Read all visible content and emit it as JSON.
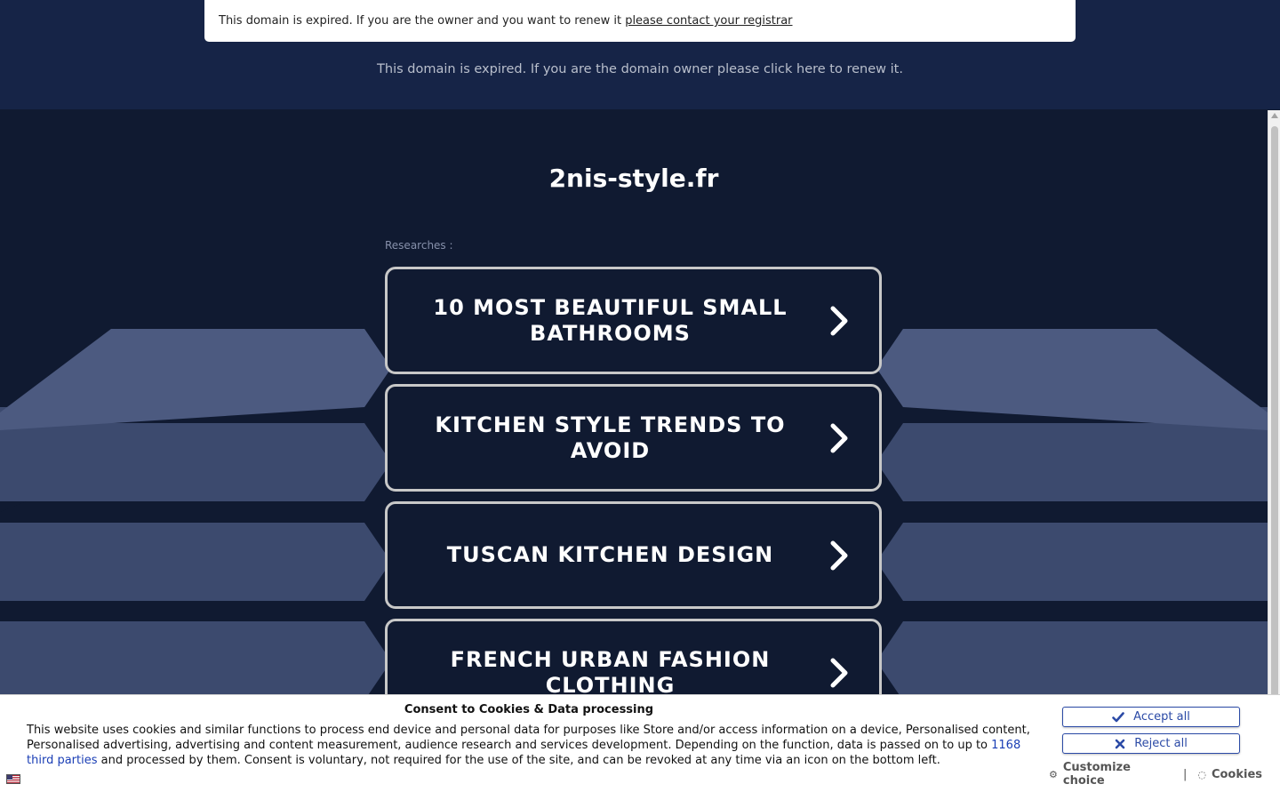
{
  "banner": {
    "notice_text": "This domain is expired. If you are the owner and you want to renew it ",
    "notice_link": "please contact your registrar",
    "renew_text": "This domain is expired. If you are the domain owner please click here to renew it."
  },
  "main": {
    "site_title": "2nis-style.fr",
    "researches_label": "Researches :",
    "links": [
      {
        "label": "10 MOST BEAUTIFUL SMALL BATHROOMS"
      },
      {
        "label": "KITCHEN STYLE TRENDS TO AVOID"
      },
      {
        "label": "TUSCAN KITCHEN DESIGN"
      },
      {
        "label": "FRENCH URBAN FASHION CLOTHING"
      }
    ]
  },
  "consent": {
    "title": "Consent to Cookies & Data processing",
    "text_before": "This website uses cookies and similar functions to process end device and personal data for purposes like Store and/or access information on a device, Personalised content, Personalised advertising, advertising and content measurement, audience research and services development. Depending on the function, data is passed on to up to ",
    "third_parties_link": "1168 third parties",
    "text_after": " and processed by them. Consent is voluntary, not required for the use of the site, and can be revoked at any time via an icon on the bottom left.",
    "accept_label": "Accept all",
    "reject_label": "Reject all",
    "customize_label": "Customize choice",
    "separator": "|",
    "cookies_label": "Cookies"
  },
  "colors": {
    "page_bg": "#101a31",
    "band_bg": "#162447",
    "accent_blue": "#2b4aa6",
    "card_border": "#c8c8c8"
  },
  "icons": {
    "chevron": "chevron-right-icon",
    "accept": "check-icon",
    "reject": "x-icon",
    "customize": "gear-icon",
    "cookies": "cookie-icon",
    "language": "flag-icon"
  }
}
